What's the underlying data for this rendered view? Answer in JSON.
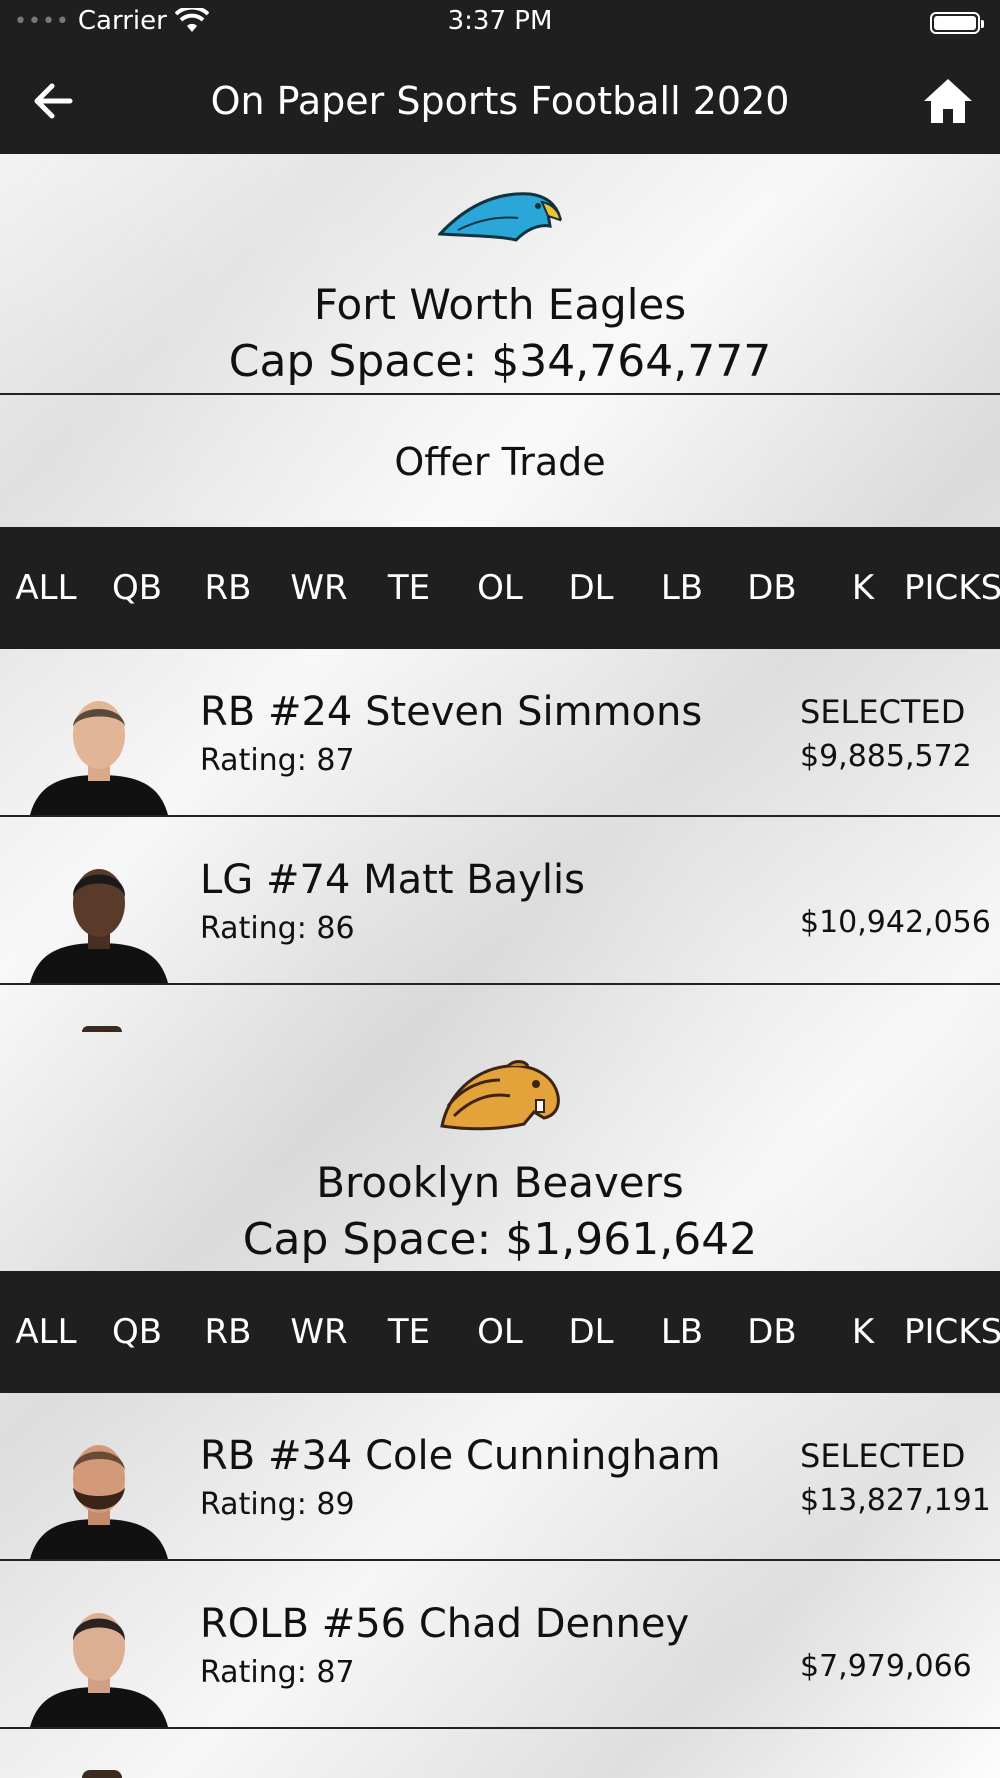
{
  "status_bar": {
    "carrier": "Carrier",
    "time": "3:37 PM"
  },
  "nav": {
    "title": "On Paper Sports Football 2020",
    "back_icon": "arrow-left-icon",
    "home_icon": "home-icon"
  },
  "team1": {
    "name": "Fort Worth Eagles",
    "cap_space": "Cap Space: $34,764,777",
    "logo_icon": "eagle-logo",
    "offer_label": "Offer Trade",
    "tabs": [
      "ALL",
      "QB",
      "RB",
      "WR",
      "TE",
      "OL",
      "DL",
      "LB",
      "DB",
      "K",
      "PICKS"
    ],
    "players": [
      {
        "name": "RB #24 Steven Simmons",
        "rating": "Rating: 87",
        "status": "SELECTED",
        "salary": "$9,885,572"
      },
      {
        "name": "LG #74 Matt Baylis",
        "rating": "Rating: 86",
        "status": "",
        "salary": "$10,942,056"
      }
    ]
  },
  "team2": {
    "name": "Brooklyn Beavers",
    "cap_space": "Cap Space: $1,961,642",
    "logo_icon": "beaver-logo",
    "tabs": [
      "ALL",
      "QB",
      "RB",
      "WR",
      "TE",
      "OL",
      "DL",
      "LB",
      "DB",
      "K",
      "PICKS"
    ],
    "players": [
      {
        "name": "RB #34 Cole Cunningham",
        "rating": "Rating: 89",
        "status": "SELECTED",
        "salary": "$13,827,191"
      },
      {
        "name": "ROLB #56 Chad Denney",
        "rating": "Rating: 87",
        "status": "",
        "salary": "$7,979,066"
      }
    ]
  },
  "colors": {
    "bar": "#1f1f1f",
    "eagle": "#2aa6d8",
    "beaver": "#e3a23a"
  }
}
